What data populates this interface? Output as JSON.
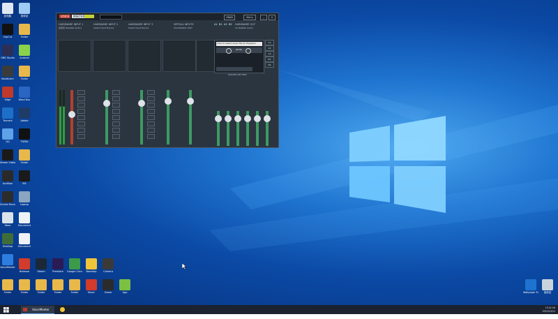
{
  "desktop": {
    "icons_left_col": [
      {
        "label": "此电脑",
        "color": "#dfe8f2"
      },
      {
        "label": "CapCut",
        "color": "#111111"
      },
      {
        "label": "OBS Studio",
        "color": "#2b2f55"
      },
      {
        "label": "Bandicam",
        "color": "#3b3b3b"
      },
      {
        "label": "Edge",
        "color": "#c0392b"
      },
      {
        "label": "Tencent",
        "color": "#1e6fc7"
      },
      {
        "label": "QQ",
        "color": "#5ea2e8"
      },
      {
        "label": "Steam Video",
        "color": "#1a1a1a"
      },
      {
        "label": "Audition",
        "color": "#2a2a2a"
      },
      {
        "label": "Screen Recorder",
        "color": "#2c2c2c"
      },
      {
        "label": "Xbox",
        "color": "#d9e3ea"
      },
      {
        "label": "Desktop",
        "color": "#3f6d3a"
      },
      {
        "label": "VoiceMeeter",
        "color": "#2d7de0"
      }
    ],
    "icons_right_col": [
      {
        "label": "回收站",
        "color": "#9ecbf4"
      },
      {
        "label": "Folder",
        "color": "#e8b84a"
      },
      {
        "label": "Android",
        "color": "#8bd24b"
      },
      {
        "label": "Folder",
        "color": "#e8b84a"
      },
      {
        "label": "Word Doc",
        "color": "#2a65c3"
      },
      {
        "label": "Adobe",
        "color": "#1f3c68"
      },
      {
        "label": "TikTok",
        "color": "#111111"
      },
      {
        "label": "Folder",
        "color": "#e8b84a"
      },
      {
        "label": "MX",
        "color": "#1a1a1a"
      },
      {
        "label": "Laptop",
        "color": "#8aa6c0"
      },
      {
        "label": "Document",
        "color": "#eef2f6"
      },
      {
        "label": "Document",
        "color": "#eef2f6"
      }
    ],
    "icons_bottom_row1": [
      {
        "label": "Netease",
        "color": "#d33b2b"
      },
      {
        "label": "Steam",
        "color": "#1b2838"
      },
      {
        "label": "Premiere",
        "color": "#2a1a55"
      },
      {
        "label": "Google Chrome",
        "color": "#3c9b4a"
      },
      {
        "label": "Bandizip",
        "color": "#f0c43a"
      },
      {
        "label": "Camera",
        "color": "#3a3a3a"
      }
    ],
    "icons_bottom_row2": [
      {
        "label": "Folder",
        "color": "#e8b84a"
      },
      {
        "label": "Folder",
        "color": "#e8b84a"
      },
      {
        "label": "Folder",
        "color": "#e8b84a"
      },
      {
        "label": "Folder",
        "color": "#e8b84a"
      },
      {
        "label": "Folder",
        "color": "#e8b84a"
      },
      {
        "label": "Music",
        "color": "#d33b2b"
      },
      {
        "label": "Game",
        "color": "#2b2b2b"
      },
      {
        "label": "App",
        "color": "#7bc043"
      }
    ],
    "icons_right": [
      {
        "label": "Wallpaper Engine",
        "color": "#1e73d1"
      },
      {
        "label": "回收站",
        "color": "#c9d3dd"
      }
    ]
  },
  "voicemeeter": {
    "logo_text": "VOICE",
    "logo_text2": "MEETER",
    "vban_label": "VBAN",
    "menu_label": "Menu",
    "minimize_label": "_",
    "close_label": "X",
    "inputs": [
      {
        "title": "HARDWARE INPUT 1",
        "sub": "麦克风 (Realtek Audio)"
      },
      {
        "title": "HARDWARE INPUT 2",
        "sub": "Select Input Device"
      },
      {
        "title": "HARDWARE INPUT 3",
        "sub": "Select Input Device"
      },
      {
        "title": "VIRTUAL INPUTS",
        "sub": "VoiceMeeter VAIO"
      }
    ],
    "output_title": "HARDWARE OUT",
    "output_sub": "A1 Realtek Audio",
    "bus_labels": [
      "A1",
      "A2",
      "A3",
      "B1",
      "B2"
    ],
    "cassette_text": "Click to Select Audio file for Playback",
    "cassette_time": "00:00",
    "master_label": "MASTER SECTION",
    "strip_fader_values": [
      -20,
      -3,
      -3,
      0,
      0
    ]
  },
  "taskbar": {
    "start_icon": "windows-start-icon",
    "active_app_label": "VoiceMeeter",
    "clock_time": "15:41:16",
    "clock_date": "2022/10/11"
  }
}
